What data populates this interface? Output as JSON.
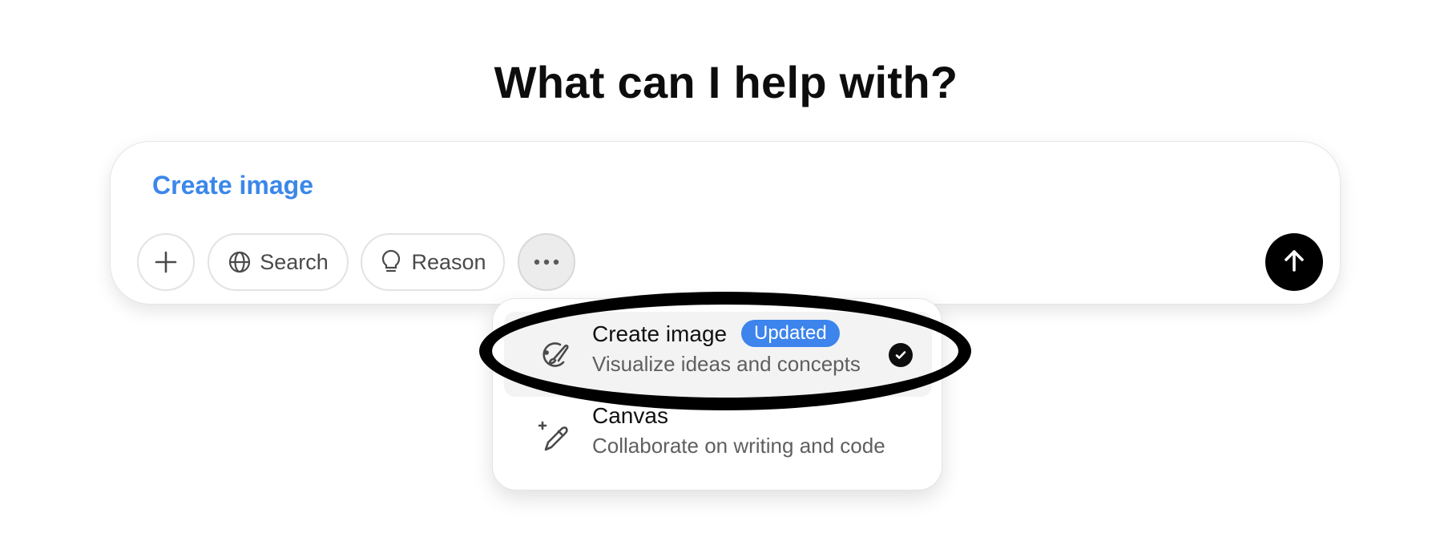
{
  "headline": "What can I help with?",
  "composer": {
    "active_tool_tag": "Create image",
    "buttons": {
      "attach_icon": "plus-icon",
      "search_label": "Search",
      "search_icon": "globe-icon",
      "reason_label": "Reason",
      "reason_icon": "lightbulb-icon",
      "more_icon": "more-dots-icon",
      "send_icon": "arrow-up-icon"
    }
  },
  "tools_menu": {
    "items": [
      {
        "title": "Create image",
        "badge": "Updated",
        "description": "Visualize ideas and concepts",
        "icon": "paintbrush-icon",
        "selected": true
      },
      {
        "title": "Canvas",
        "description": "Collaborate on writing and code",
        "icon": "pencil-sparkle-icon",
        "selected": false
      }
    ]
  },
  "colors": {
    "accent": "#3b87ea",
    "badge": "#3d84ec",
    "send_button": "#000000",
    "annotation": "#000000"
  }
}
